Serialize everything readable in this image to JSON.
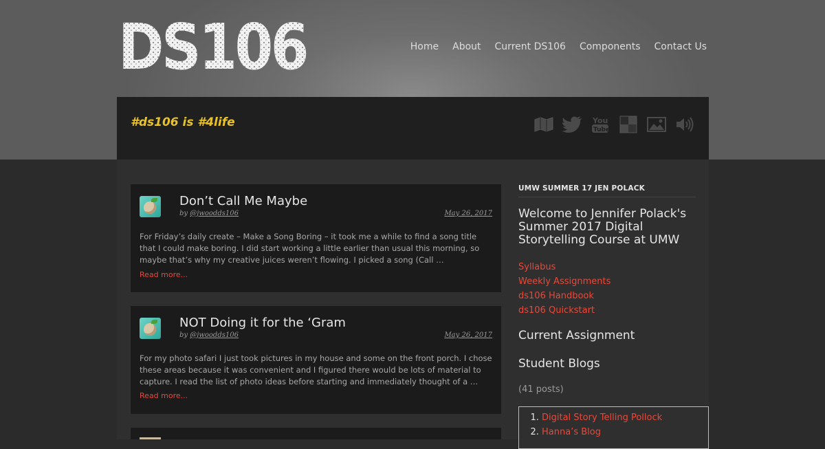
{
  "site": {
    "logo_text": "DS106",
    "tagline": "#ds106 is #4life"
  },
  "nav": {
    "items": [
      {
        "label": "Home"
      },
      {
        "label": "About"
      },
      {
        "label": "Current DS106"
      },
      {
        "label": "Components"
      },
      {
        "label": "Contact Us"
      }
    ]
  },
  "social_icons": [
    "map-icon",
    "twitter-icon",
    "youtube-icon",
    "delicious-icon",
    "image-icon",
    "audio-icon"
  ],
  "posts": [
    {
      "title": "Don’t Call Me Maybe",
      "by": "by ",
      "author": "@jwoodds106",
      "date": "May 26, 2017",
      "excerpt": "For Friday’s daily create – Make a Song Boring – it took me a while to find a song title that I could make boring. I did start working a little earlier than usual this morning, so maybe that’s why my creative juices weren’t flowing. I picked a song (Call …",
      "read_more": "Read more..."
    },
    {
      "title": "NOT Doing it for the ‘Gram",
      "by": "by ",
      "author": "@jwoodds106",
      "date": "May 26, 2017",
      "excerpt": "For my photo safari I just took pictures in my house and some on the front porch. I chose these areas because it was convenient and I figured there would be lots of material to capture. I read the list of photo ideas before starting and immediately thought of a …",
      "read_more": "Read more..."
    }
  ],
  "sidebar": {
    "heading": "UMW SUMMER 17 JEN POLACK",
    "welcome": "Welcome to Jennifer Polack's Summer 2017 Digital Storytelling Course at UMW",
    "links": [
      {
        "label": "Syllabus"
      },
      {
        "label": "Weekly Assignments"
      },
      {
        "label": "ds106 Handbook"
      },
      {
        "label": "ds106 Quickstart"
      }
    ],
    "current_assignment": "Current Assignment",
    "student_blogs": "Student Blogs",
    "post_count": "(41 posts)",
    "blogs": [
      {
        "label": "Digital Story Telling Pollock"
      },
      {
        "label": "Hanna’s Blog"
      }
    ]
  },
  "colors": {
    "accent_red": "#ef4637",
    "tagline_yellow": "#e9c227"
  }
}
